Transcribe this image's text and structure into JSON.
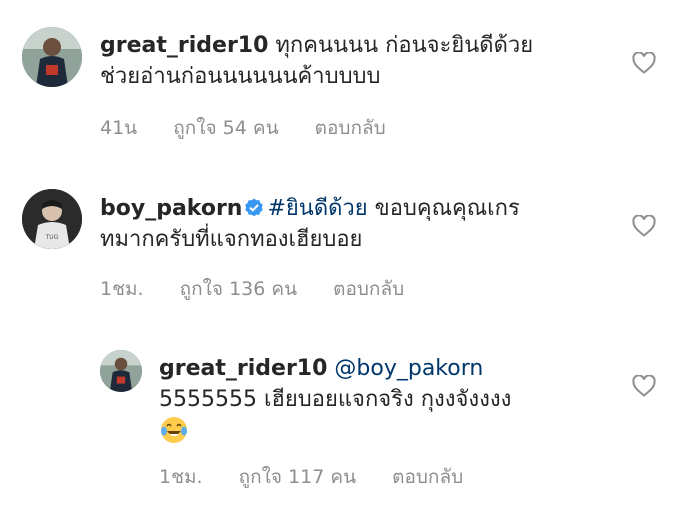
{
  "comments": [
    {
      "username": "great_rider10",
      "text_line1": "ทุกคนนนน ก่อนจะยินดีด้วย",
      "text_line2": "ช่วยอ่านก่อนนนนนนค้าบบบบ",
      "time": "41น",
      "likes": "ถูกใจ 54 คน",
      "reply": "ตอบกลับ"
    },
    {
      "username": "boy_pakorn",
      "hashtag": "#ยินดีด้วย",
      "text_line1_rest": "ขอบคุณคุณเกร",
      "text_line2": "ทมากครับที่แจกทองเฮียบอย",
      "time": "1ชม.",
      "likes": "ถูกใจ 136 คน",
      "reply": "ตอบกลับ"
    },
    {
      "username": "great_rider10",
      "mention": "@boy_pakorn",
      "text_line2": "5555555 เฮียบอยแจกจริง กุงงจังงงง",
      "time": "1ชม.",
      "likes": "ถูกใจ 117 คน",
      "reply": "ตอบกลับ"
    }
  ],
  "icons": {
    "like": "heart-outline-icon",
    "verified": "verified-badge-icon",
    "emoji": "face-with-tears-of-joy-icon"
  },
  "colors": {
    "text": "#262626",
    "meta": "#8e8e8e",
    "link": "#00376b",
    "verified": "#3897f0"
  }
}
